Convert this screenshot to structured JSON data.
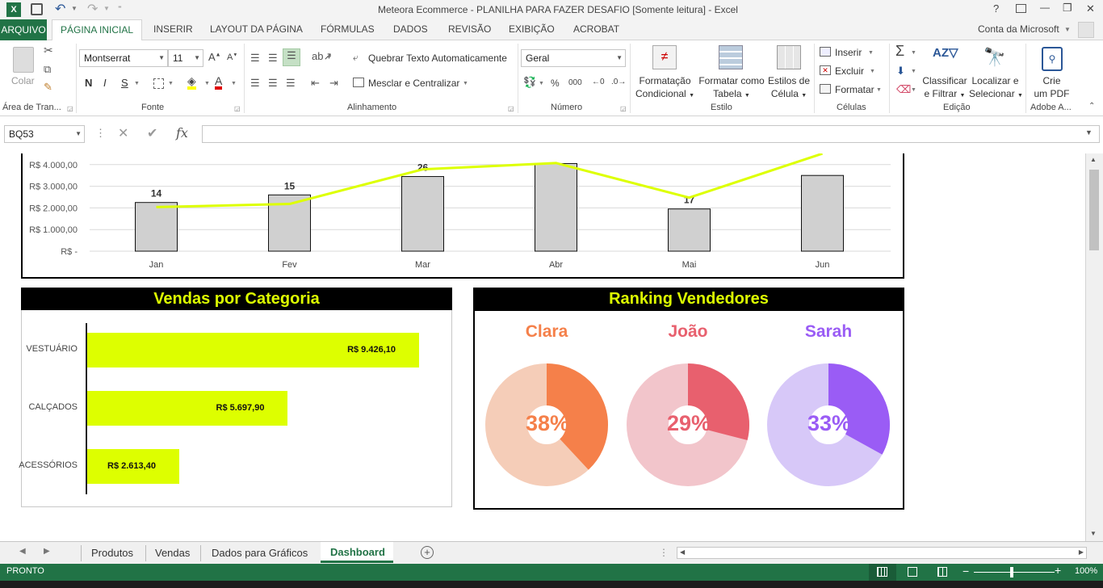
{
  "window": {
    "title": "Meteora Ecommerce - PLANILHA PARA FAZER DESAFIO  [Somente leitura] - Excel",
    "help": "?",
    "minimize": "—",
    "restore": "❐",
    "close": "✕"
  },
  "ribbon_tabs": {
    "file": "ARQUIVO",
    "items": [
      "PÁGINA INICIAL",
      "INSERIR",
      "LAYOUT DA PÁGINA",
      "FÓRMULAS",
      "DADOS",
      "REVISÃO",
      "EXIBIÇÃO",
      "ACROBAT"
    ],
    "account": "Conta da Microsoft"
  },
  "ribbon": {
    "clipboard": {
      "paste": "Colar",
      "group": "Área de Tran..."
    },
    "font": {
      "name": "Montserrat",
      "size": "11",
      "bold": "N",
      "italic": "I",
      "underline": "S",
      "group": "Fonte"
    },
    "alignment": {
      "wrap": "Quebrar Texto Automaticamente",
      "merge": "Mesclar e Centralizar",
      "group": "Alinhamento"
    },
    "number": {
      "format": "Geral",
      "percent": "%",
      "thousands": "000",
      "group": "Número"
    },
    "styles": {
      "conditional": [
        "Formatação",
        "Condicional"
      ],
      "table": [
        "Formatar como",
        "Tabela"
      ],
      "cell": [
        "Estilos de",
        "Célula"
      ],
      "group": "Estilo"
    },
    "cells": {
      "insert": "Inserir",
      "delete": "Excluir",
      "format": "Formatar",
      "group": "Células"
    },
    "editing": {
      "sort": [
        "Classificar",
        "e Filtrar"
      ],
      "find": [
        "Localizar e",
        "Selecionar"
      ],
      "group": "Edição"
    },
    "adobe": {
      "create": [
        "Crie",
        "um PDF"
      ],
      "group": "Adobe A..."
    }
  },
  "formula_bar": {
    "name_box": "BQ53",
    "fx": "fx",
    "value": ""
  },
  "chart_data": [
    {
      "type": "bar+line",
      "categories": [
        "Jan",
        "Fev",
        "Mar",
        "Abr",
        "Mai",
        "Jun"
      ],
      "series": [
        {
          "values": [
            2250,
            2600,
            3450,
            4050,
            1950,
            3500
          ]
        },
        {
          "values": [
            14,
            15,
            26,
            28,
            17,
            31
          ]
        }
      ],
      "data_labels": [
        "14",
        "15",
        "26",
        "",
        "17",
        ""
      ],
      "y_ticks": [
        "R$ -",
        "R$ 1.000,00",
        "R$ 2.000,00",
        "R$ 3.000,00",
        "R$ 4.000,00"
      ],
      "ylim": [
        0,
        4000
      ],
      "colors": {
        "bar": "#d0d0d0",
        "line": "#ddff00"
      }
    },
    {
      "type": "bar",
      "title": "Vendas por Categoria",
      "categories": [
        "VESTUÁRIO",
        "CALÇADOS",
        "ACESSÓRIOS"
      ],
      "values": [
        9426.1,
        5697.9,
        2613.4
      ],
      "data_labels": [
        "R$ 9.426,10",
        "R$ 5.697,90",
        "R$ 2.613,40"
      ],
      "colors": {
        "bar": "#ddff00"
      }
    },
    {
      "type": "pie",
      "title": "Ranking Vendedores",
      "sellers": [
        {
          "name": "Clara",
          "value": 38,
          "label": "38%",
          "color": "#f5804a",
          "track": "#f5cdb8"
        },
        {
          "name": "João",
          "value": 29,
          "label": "29%",
          "color": "#e8606e",
          "track": "#f2c5cb"
        },
        {
          "name": "Sarah",
          "value": 33,
          "label": "33%",
          "color": "#9a5cf5",
          "track": "#d7c8f8"
        }
      ]
    }
  ],
  "sheet_tabs": [
    "Produtos",
    "Vendas",
    "Dados para Gráficos",
    "Dashboard"
  ],
  "active_sheet": "Dashboard",
  "status": {
    "mode": "PRONTO",
    "zoom": "100%"
  }
}
